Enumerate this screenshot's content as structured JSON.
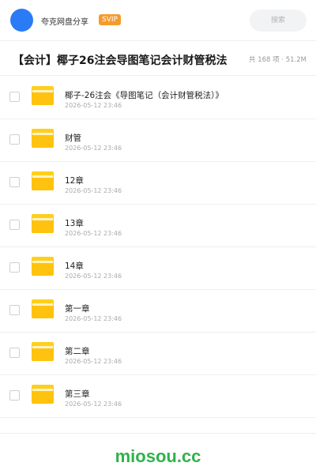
{
  "header": {
    "username": "夸克网盘分享",
    "badge": "SVIP",
    "search_placeholder": "搜索"
  },
  "share": {
    "title": "【会计】椰子26注会导图笔记会计财管税法",
    "meta": "共 168 项 · 51.2M"
  },
  "files": [
    {
      "name": "椰子-26注会《导图笔记（会计财管税法）》",
      "date": "2026-05-12 23:46"
    },
    {
      "name": "财管",
      "date": "2026-05-12 23:46"
    },
    {
      "name": "12章",
      "date": "2026-05-12 23:46"
    },
    {
      "name": "13章",
      "date": "2026-05-12 23:46"
    },
    {
      "name": "14章",
      "date": "2026-05-12 23:46"
    },
    {
      "name": "第一章",
      "date": "2026-05-12 23:46"
    },
    {
      "name": "第二章",
      "date": "2026-05-12 23:46"
    },
    {
      "name": "第三章",
      "date": "2026-05-12 23:46"
    }
  ],
  "footer": {
    "brand": "miosou.cc"
  },
  "colors": {
    "accent": "#2a7bf6",
    "badge": "#f59b2b",
    "folder": "#ffc20e",
    "brand": "#2fb24c"
  }
}
